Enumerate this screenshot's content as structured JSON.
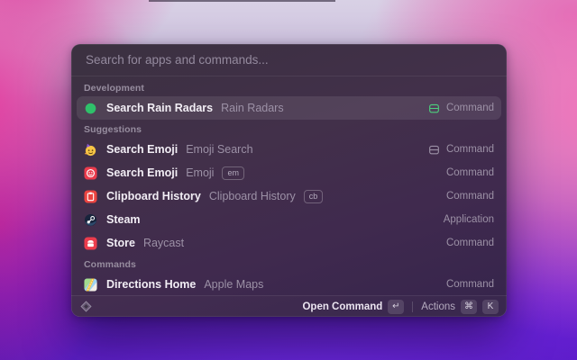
{
  "search": {
    "placeholder": "Search for apps and commands..."
  },
  "sections": [
    {
      "title": "Development",
      "items": [
        {
          "title": "Search Rain Radars",
          "subtitle": "Rain Radars",
          "icon": "green-circle-icon",
          "badge": null,
          "accessory_icon": "command-outline-icon-green",
          "accessory": "Command",
          "selected": true
        }
      ]
    },
    {
      "title": "Suggestions",
      "items": [
        {
          "title": "Search Emoji",
          "subtitle": "Emoji Search",
          "icon": "party-emoji-icon",
          "badge": null,
          "accessory_icon": "command-outline-icon-gray",
          "accessory": "Command",
          "selected": false
        },
        {
          "title": "Search Emoji",
          "subtitle": "Emoji",
          "icon": "red-emoji-icon",
          "badge": "em",
          "accessory_icon": null,
          "accessory": "Command",
          "selected": false
        },
        {
          "title": "Clipboard History",
          "subtitle": "Clipboard History",
          "icon": "clipboard-icon",
          "badge": "cb",
          "accessory_icon": null,
          "accessory": "Command",
          "selected": false
        },
        {
          "title": "Steam",
          "subtitle": null,
          "icon": "steam-icon",
          "badge": null,
          "accessory_icon": null,
          "accessory": "Application",
          "selected": false
        },
        {
          "title": "Store",
          "subtitle": "Raycast",
          "icon": "store-icon",
          "badge": null,
          "accessory_icon": null,
          "accessory": "Command",
          "selected": false
        }
      ]
    },
    {
      "title": "Commands",
      "items": [
        {
          "title": "Directions Home",
          "subtitle": "Apple Maps",
          "icon": "maps-icon",
          "badge": null,
          "accessory_icon": null,
          "accessory": "Command",
          "selected": false
        }
      ]
    }
  ],
  "footer": {
    "logo": "raycast-logo-icon",
    "primary_action": "Open Command",
    "primary_key": "↵",
    "secondary_action": "Actions",
    "secondary_keys": [
      "⌘",
      "K"
    ]
  },
  "colors": {
    "selection_green": "#2fc06a",
    "accessory_green": "#4cd07d",
    "extension_red": "#eb3c4d",
    "highlight": "rgba(255,255,255,0.09)"
  }
}
